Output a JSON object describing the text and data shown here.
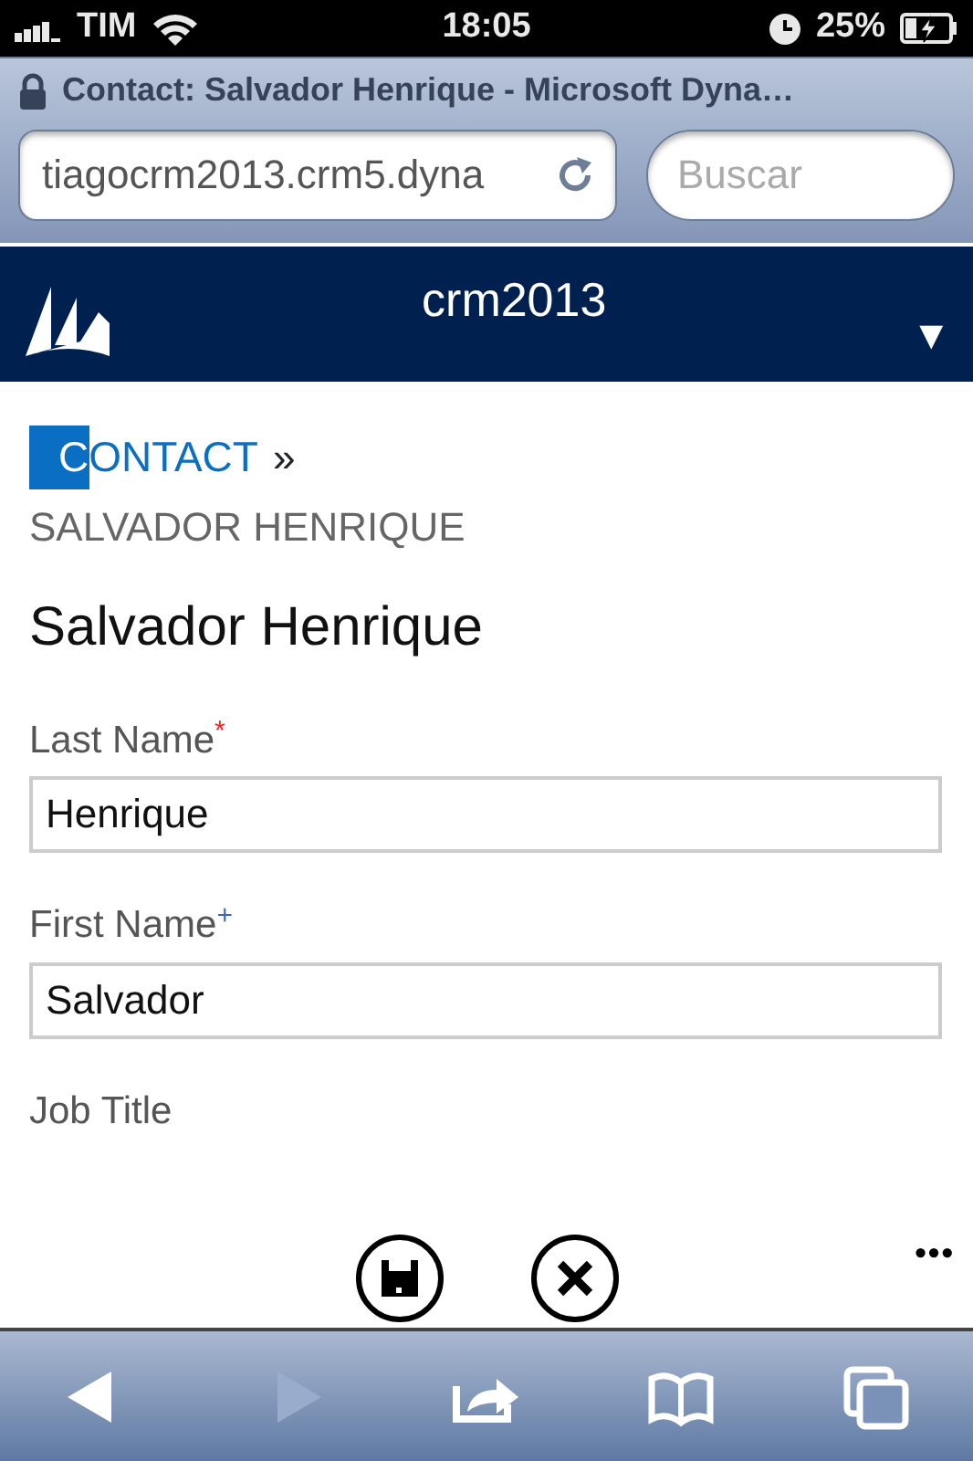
{
  "status_bar": {
    "carrier": "TIM",
    "time": "18:05",
    "battery": "25%",
    "charging": true
  },
  "browser": {
    "page_title": "Contact: Salvador Henrique - Microsoft Dyna…",
    "secure": true,
    "url": "tiagocrm2013.crm5.dyna",
    "search": {
      "placeholder": "Buscar"
    }
  },
  "app_bar": {
    "title": "crm2013",
    "menu": "▼"
  },
  "breadcrumb": {
    "entity": "CONTACT",
    "focused": true,
    "separator": "»"
  },
  "record_subtitle": "SALVADOR HENRIQUE",
  "record_title": "Salvador Henrique",
  "fields": [
    {
      "label": "Last Name",
      "required": true,
      "marker": "*",
      "value": "Henrique"
    },
    {
      "label": "First Name",
      "required": false,
      "marker": "+",
      "value": "Salvador"
    },
    {
      "label": "Job Title"
    }
  ],
  "command_bar": {
    "more": "•••",
    "buttons": [
      {
        "kind": "save"
      },
      {
        "kind": "close"
      }
    ]
  },
  "toolbar": [
    {
      "kind": "back",
      "disabled": false
    },
    {
      "kind": "forward",
      "disabled": true
    },
    {
      "kind": "share",
      "disabled": false
    },
    {
      "kind": "bookmarks",
      "disabled": false
    },
    {
      "kind": "tabs",
      "disabled": false
    }
  ]
}
